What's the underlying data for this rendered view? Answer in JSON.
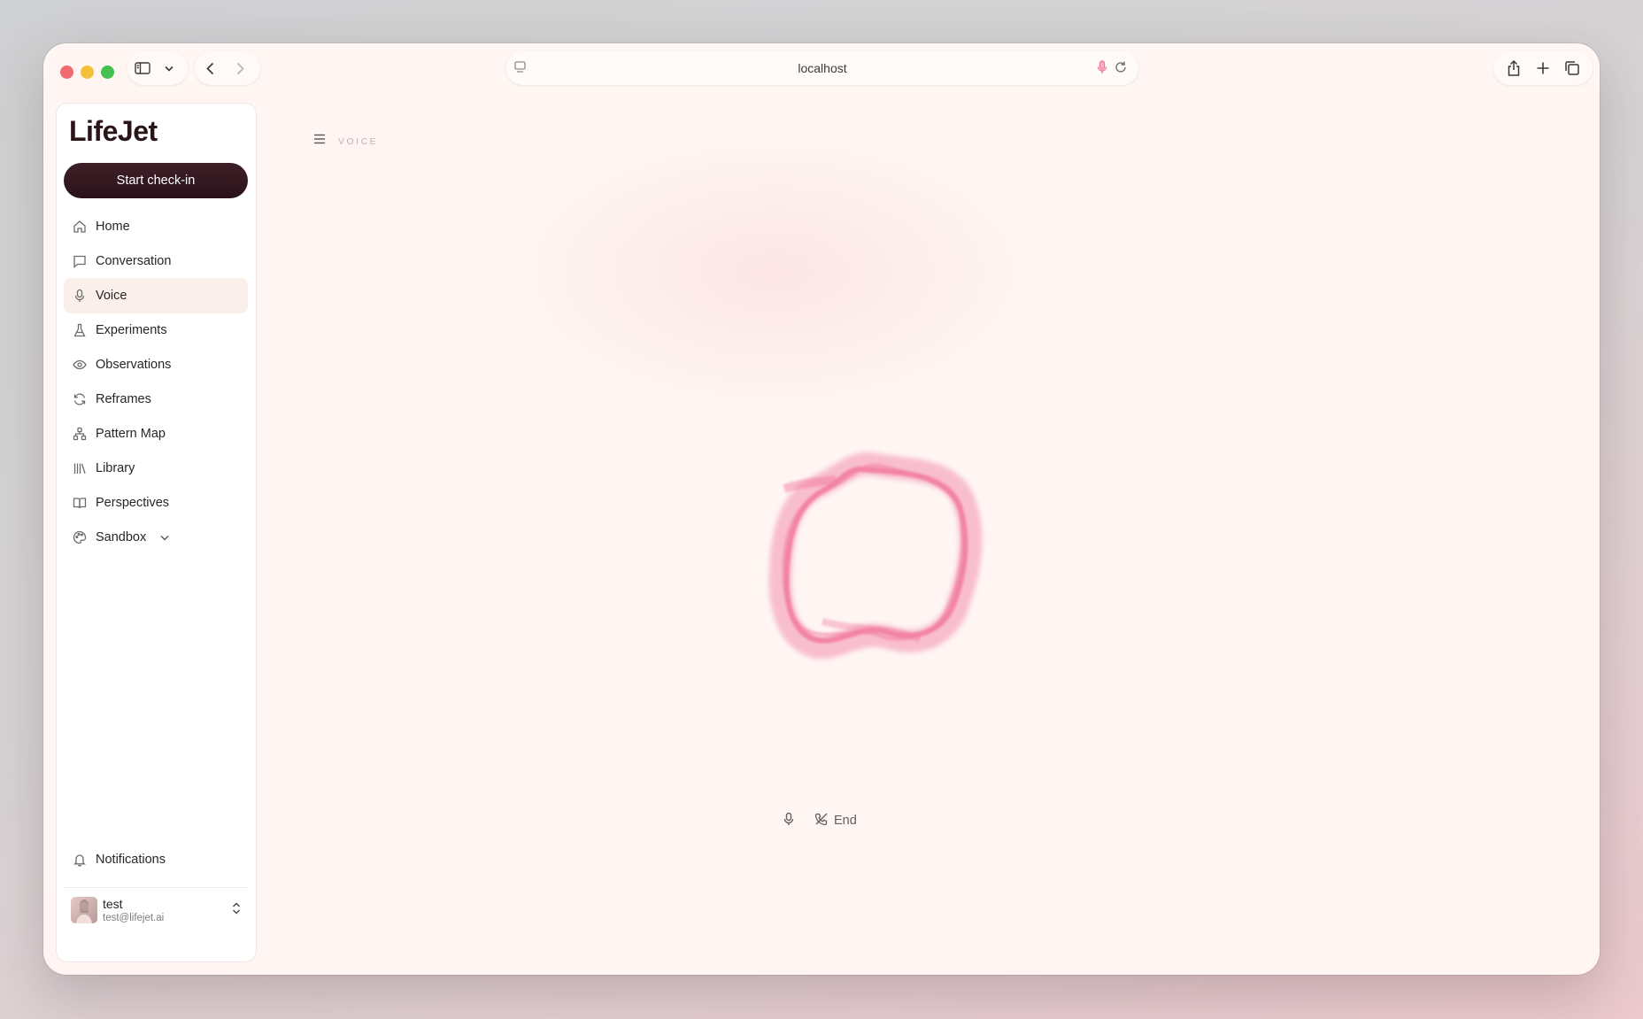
{
  "browser": {
    "url": "localhost"
  },
  "app": {
    "logo": "LifeJet",
    "primary_button": "Start check-in"
  },
  "sidebar": {
    "items": [
      {
        "label": "Home",
        "icon": "home-icon"
      },
      {
        "label": "Conversation",
        "icon": "chat-icon"
      },
      {
        "label": "Voice",
        "icon": "mic-icon",
        "active": true
      },
      {
        "label": "Experiments",
        "icon": "flask-icon"
      },
      {
        "label": "Observations",
        "icon": "eye-icon"
      },
      {
        "label": "Reframes",
        "icon": "refresh-icon"
      },
      {
        "label": "Pattern Map",
        "icon": "network-icon"
      },
      {
        "label": "Library",
        "icon": "library-icon"
      },
      {
        "label": "Perspectives",
        "icon": "book-icon"
      },
      {
        "label": "Sandbox",
        "icon": "palette-icon"
      }
    ],
    "notifications": "Notifications",
    "user": {
      "name": "test",
      "email": "test@lifejet.ai"
    }
  },
  "main": {
    "breadcrumb": "VOICE",
    "end_label": "End"
  },
  "colors": {
    "accent_dark": "#2a121a",
    "orb_pink": "#f06b95",
    "active_bg": "#fbefec",
    "background": "#fff6f3"
  }
}
